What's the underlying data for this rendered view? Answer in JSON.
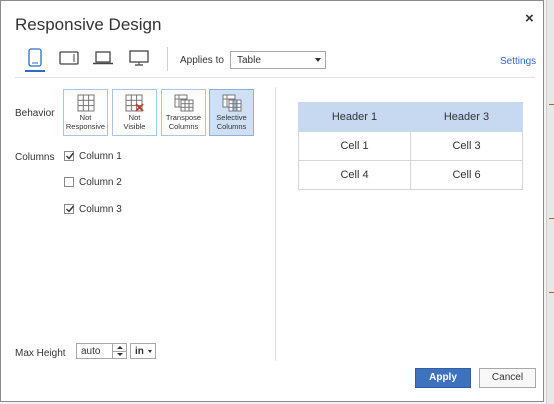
{
  "dialog": {
    "title": "Responsive Design",
    "close_glyph": "×"
  },
  "devices": [
    {
      "name": "phone-icon",
      "active": true
    },
    {
      "name": "tablet-icon",
      "active": false
    },
    {
      "name": "laptop-icon",
      "active": false
    },
    {
      "name": "desktop-icon",
      "active": false
    }
  ],
  "applies_to": {
    "label": "Applies to",
    "value": "Table"
  },
  "settings_link": "Settings",
  "behavior": {
    "label": "Behavior",
    "options": [
      {
        "line1": "Not",
        "line2": "Responsive",
        "icon": "grid-icon",
        "selected": false
      },
      {
        "line1": "Not",
        "line2": "Visible",
        "icon": "grid-x-icon",
        "selected": false
      },
      {
        "line1": "Transpose",
        "line2": "Columns",
        "icon": "transpose-icon",
        "selected": false
      },
      {
        "line1": "Selective",
        "line2": "Columns",
        "icon": "selective-columns-icon",
        "selected": true
      }
    ]
  },
  "columns": {
    "label": "Columns",
    "items": [
      {
        "label": "Column 1",
        "checked": true
      },
      {
        "label": "Column 2",
        "checked": false
      },
      {
        "label": "Column 3",
        "checked": true
      }
    ]
  },
  "max_height": {
    "label": "Max Height",
    "value": "auto",
    "unit": "in"
  },
  "preview_table": {
    "headers": [
      "Header 1",
      "Header 3"
    ],
    "rows": [
      [
        "Cell 1",
        "Cell 3"
      ],
      [
        "Cell 4",
        "Cell 6"
      ]
    ]
  },
  "buttons": {
    "apply": "Apply",
    "cancel": "Cancel"
  },
  "colors": {
    "accent": "#2b6cc4",
    "apply_bg": "#3e72be",
    "selected_bg": "#cfe0f5",
    "header_bg": "#c6d9f0"
  }
}
